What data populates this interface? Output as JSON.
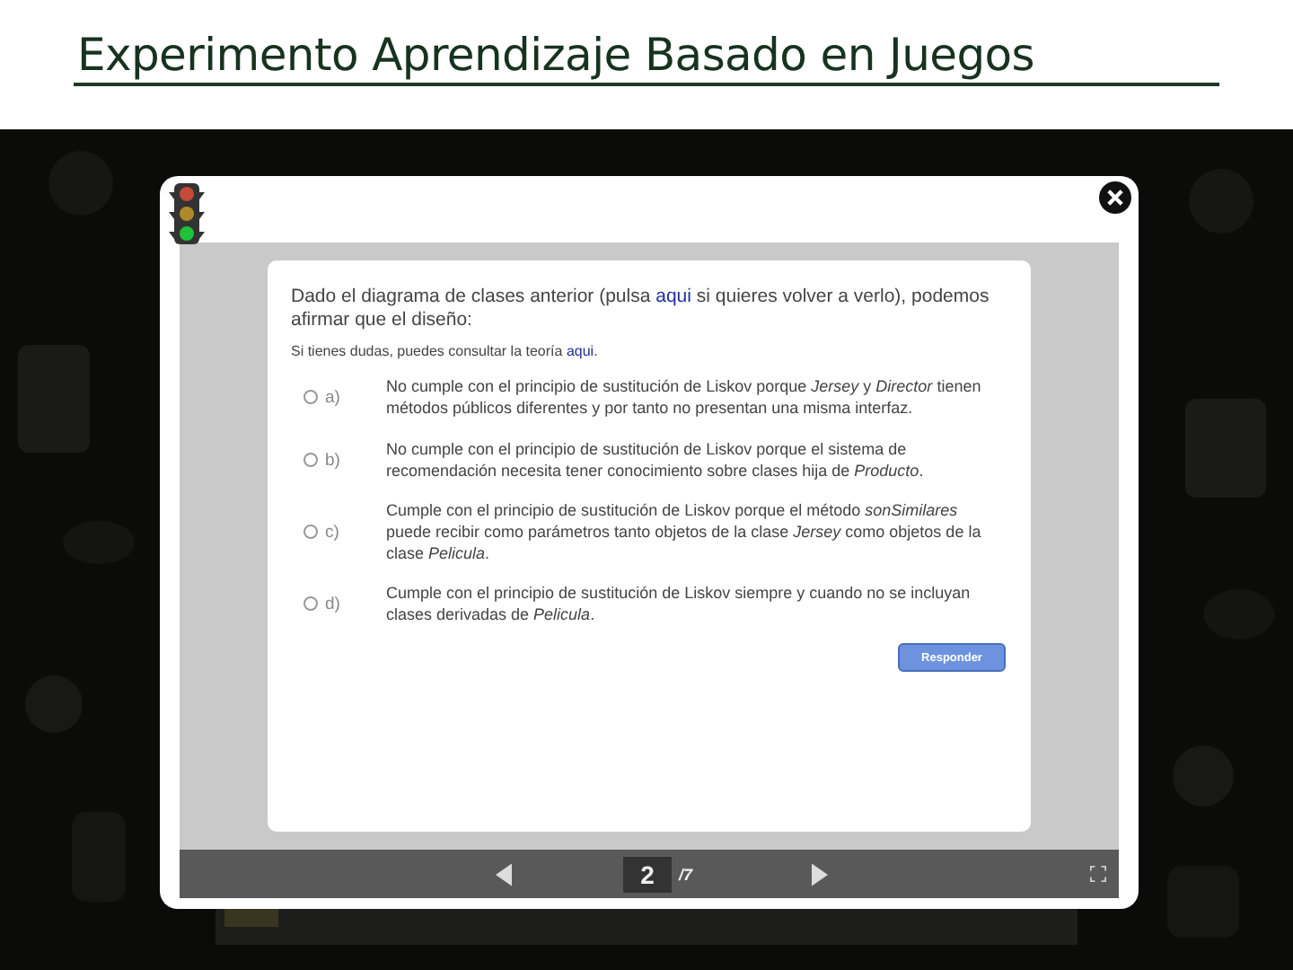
{
  "slide_title": "Experimento Aprendizaje Basado en Juegos",
  "question": {
    "before": "Dado el diagrama de clases anterior (pulsa ",
    "link": "aqui",
    "after": " si quieres volver a verlo), podemos afirmar que el diseño:"
  },
  "hint": {
    "before": "Si tienes dudas, puedes consultar la teoría ",
    "link": "aqui",
    "after": "."
  },
  "options": [
    {
      "letter": "a)",
      "text": "No cumple con el principio de sustitución de Liskov porque *Jersey* y *Director* tienen métodos públicos diferentes y por tanto no presentan una misma interfaz.",
      "selected": false
    },
    {
      "letter": "b)",
      "text": "No cumple con el principio de sustitución de Liskov porque el sistema de recomendación necesita tener conocimiento sobre clases hija de *Producto*.",
      "selected": false
    },
    {
      "letter": "c)",
      "text": "Cumple con el principio de sustitución de Liskov porque el método *sonSimilares* puede recibir como parámetros tanto objetos de la clase *Jersey* como objetos de la clase *Pelicula*.",
      "selected": false
    },
    {
      "letter": "d)",
      "text": "Cumple con el principio de sustitución de Liskov siempre y cuando no se incluyan clases derivadas de *Pelicula*.",
      "selected": false
    }
  ],
  "submit_button": "Responder",
  "pager": {
    "current": "2",
    "total": "/7"
  }
}
